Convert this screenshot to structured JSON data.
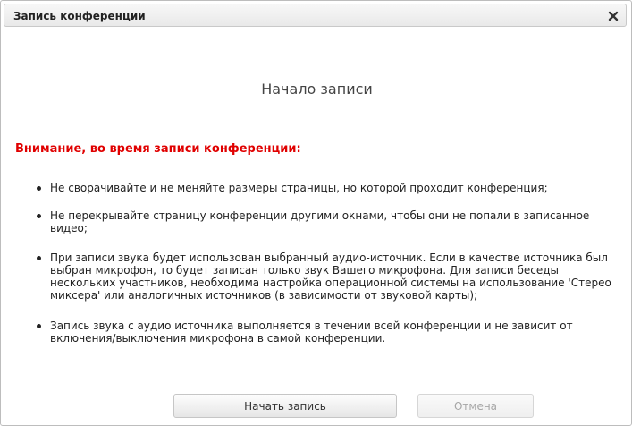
{
  "dialog": {
    "title": "Запись конференции",
    "close_icon": "close-icon"
  },
  "content": {
    "heading": "Начало записи",
    "warning": "Внимание, во время записи конференции:",
    "notes": [
      "Не сворачивайте и не меняйте размеры страницы, но которой проходит конференция;",
      "Не перекрывайте страницу конференции другими окнами, чтобы они не попали в записанное видео;",
      "При записи звука будет использован выбранный аудио-источник. Если в качестве источника был выбран микрофон, то будет записан только звук Вашего микрофона. Для записи беседы нескольких участников, необходима настройка операционной системы на использование 'Стерео миксера' или аналогичных источников (в зависимости от звуковой карты);",
      "Запись звука с аудио источника выполняется в течении всей конференции и не зависит от включения/выключения микрофона в самой конференции."
    ],
    "warning_color": "#e00000"
  },
  "buttons": {
    "start_label": "Начать запись",
    "cancel_label": "Отмена",
    "cancel_disabled": true
  }
}
